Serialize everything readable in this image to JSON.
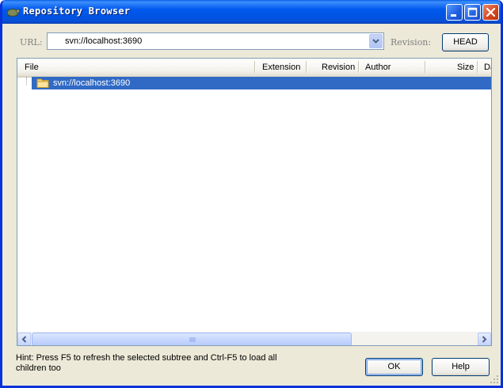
{
  "window": {
    "title": "Repository Browser"
  },
  "toolbar": {
    "url_label": "URL:",
    "url_value": "svn://localhost:3690",
    "revision_label": "Revision:",
    "revision_button": "HEAD"
  },
  "list": {
    "columns": [
      "File",
      "Extension",
      "Revision",
      "Author",
      "Size",
      "Da"
    ],
    "rows": [
      {
        "file": "svn://localhost:3690",
        "selected": true
      }
    ]
  },
  "footer": {
    "hint": "Hint: Press F5 to refresh the selected subtree and Ctrl-F5 to load all children too",
    "ok_label": "OK",
    "help_label": "Help"
  },
  "colors": {
    "title_bar": "#0054e3",
    "selection": "#316ac5",
    "dialog_bg": "#ece9d8",
    "close_button": "#d4461c"
  }
}
